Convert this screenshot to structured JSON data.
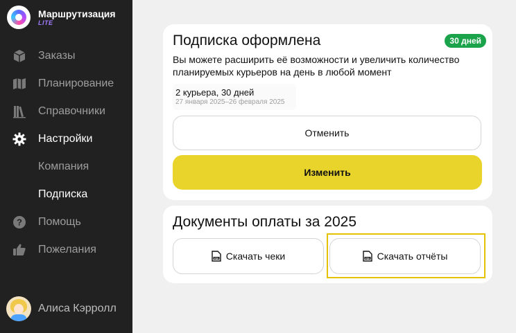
{
  "brand": {
    "name": "Маршрутизация",
    "tag": "LITE"
  },
  "nav": {
    "items": [
      {
        "label": "Заказы",
        "icon": "box-icon"
      },
      {
        "label": "Планирование",
        "icon": "map-icon"
      },
      {
        "label": "Справочники",
        "icon": "books-icon"
      },
      {
        "label": "Настройки",
        "icon": "gear-icon"
      }
    ],
    "settings_sub": [
      {
        "label": "Компания"
      },
      {
        "label": "Подписка"
      }
    ],
    "bottom_items": [
      {
        "label": "Помощь",
        "icon": "help-icon"
      },
      {
        "label": "Пожелания",
        "icon": "thumbs-up-icon"
      }
    ]
  },
  "user": {
    "name": "Алиса Кэрролл"
  },
  "subscription": {
    "title": "Подписка оформлена",
    "badge": "30 дней",
    "description": "Вы можете расширить её возможности и увеличить количество планируемых курьеров на день в любой момент",
    "plan_name": "2 курьера, 30 дней",
    "plan_dates": "27 января 2025–26 февраля 2025",
    "cancel_label": "Отменить",
    "change_label": "Изменить"
  },
  "documents": {
    "title": "Документы оплаты за 2025",
    "receipts_label": "Скачать чеки",
    "reports_label": "Скачать отчёты"
  },
  "colors": {
    "sidebar_bg": "#212121",
    "accent_yellow": "#e9d42c",
    "badge_green": "#1aa34a",
    "focus_outline": "#e5c200"
  }
}
